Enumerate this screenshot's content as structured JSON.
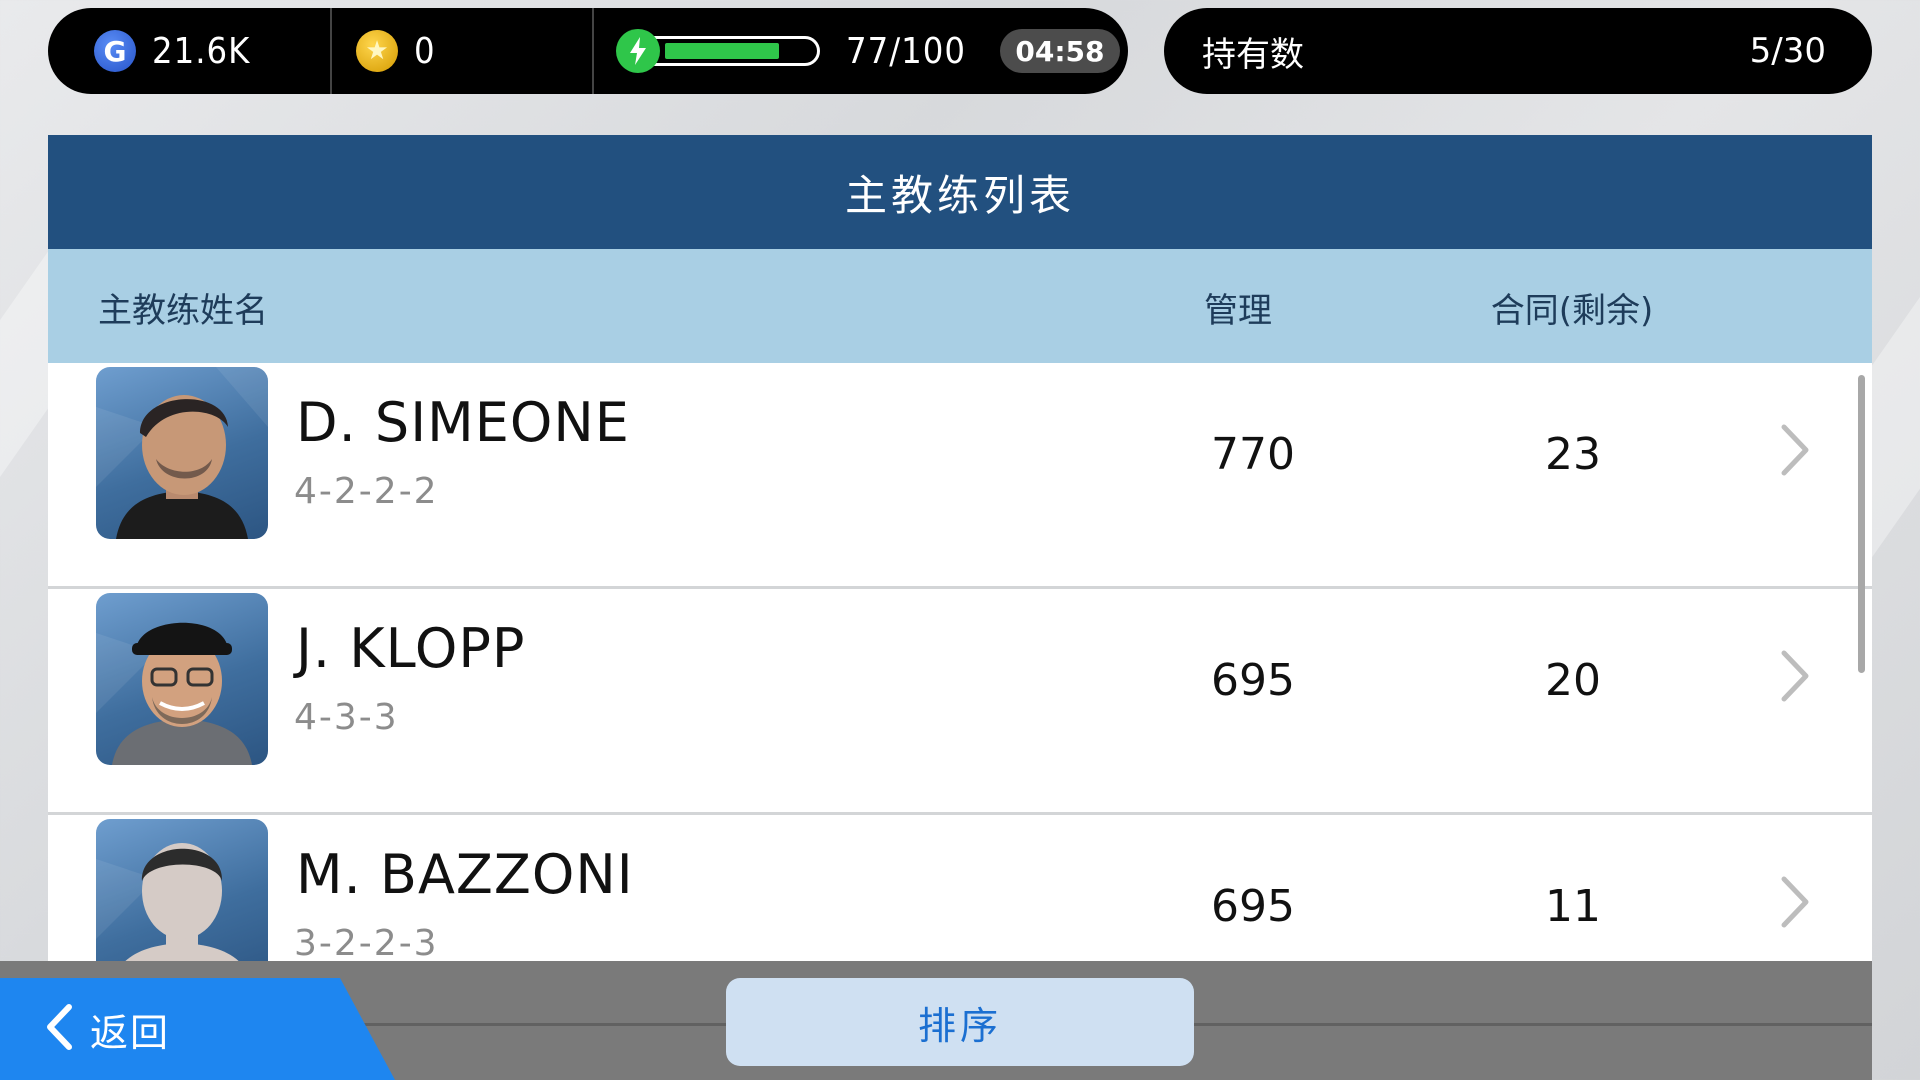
{
  "resources": {
    "gp_icon": "G",
    "gp_value": "21.6K",
    "coin_value": "0",
    "energy_current": 77,
    "energy_max": 100,
    "energy_text": "77/100",
    "timer": "04:58"
  },
  "holdings": {
    "label": "持有数",
    "value": "5/30"
  },
  "panel": {
    "title": "主教练列表",
    "columns": {
      "name": "主教练姓名",
      "management": "管理",
      "contract": "合同(剩余)"
    }
  },
  "coaches": [
    {
      "name": "D. SIMEONE",
      "formation": "4-2-2-2",
      "management": "770",
      "contract": "23"
    },
    {
      "name": "J. KLOPP",
      "formation": "4-3-3",
      "management": "695",
      "contract": "20"
    },
    {
      "name": "M. BAZZONI",
      "formation": "3-2-2-3",
      "management": "695",
      "contract": "11"
    }
  ],
  "footer": {
    "back_label": "返回",
    "sort_label": "排序"
  },
  "colors": {
    "title_bg": "#22507f",
    "header_bg": "#a9cfe4",
    "back_bg": "#1e86f0",
    "energy": "#2fc64a"
  },
  "icons": [
    "gp-icon",
    "coin-star-icon",
    "energy-bolt-icon",
    "chevron-right-icon",
    "back-arrow-icon"
  ]
}
